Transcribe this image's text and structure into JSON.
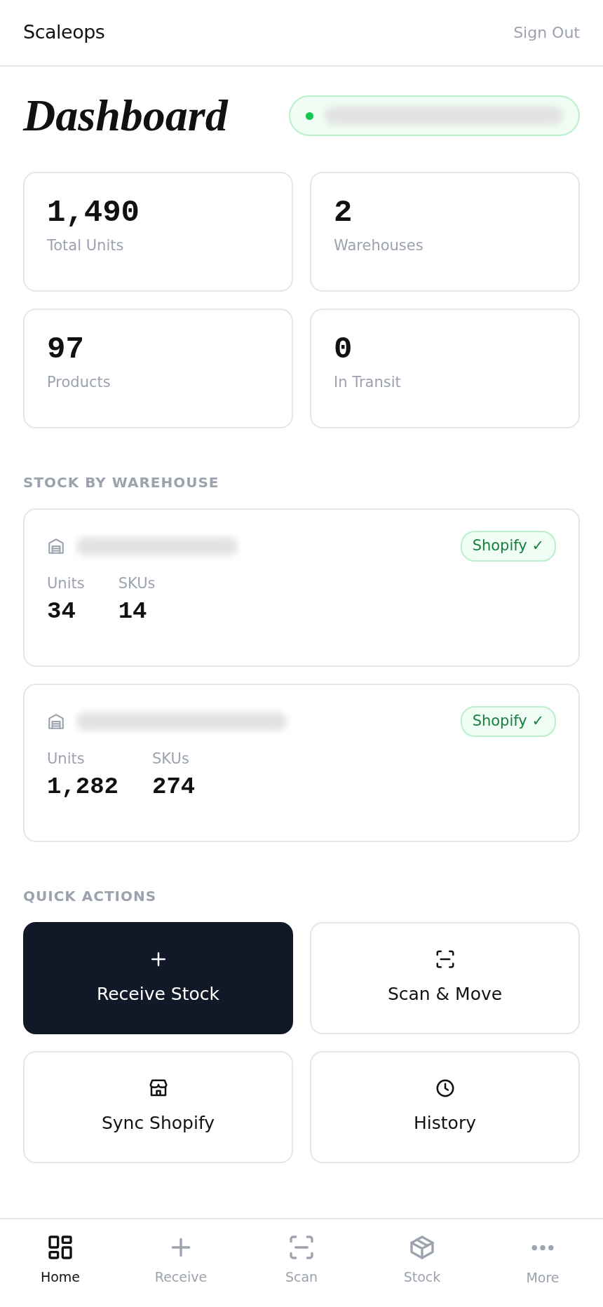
{
  "header": {
    "brand": "Scaleops",
    "sign_out": "Sign Out"
  },
  "page_title": "Dashboard",
  "stats": [
    {
      "value": "1,490",
      "label": "Total Units"
    },
    {
      "value": "2",
      "label": "Warehouses"
    },
    {
      "value": "97",
      "label": "Products"
    },
    {
      "value": "0",
      "label": "In Transit"
    }
  ],
  "warehouses_section": {
    "title": "STOCK BY WAREHOUSE",
    "warehouses": [
      {
        "badge": "Shopify ✓",
        "units_label": "Units",
        "units": "34",
        "skus_label": "SKUs",
        "skus": "14"
      },
      {
        "badge": "Shopify ✓",
        "units_label": "Units",
        "units": "1,282",
        "skus_label": "SKUs",
        "skus": "274"
      }
    ]
  },
  "quick_actions": {
    "title": "QUICK ACTIONS",
    "actions": [
      {
        "label": "Receive Stock",
        "kind": "primary"
      },
      {
        "label": "Scan & Move",
        "kind": "outline"
      },
      {
        "label": "Sync Shopify",
        "kind": "outline"
      },
      {
        "label": "History",
        "kind": "outline"
      }
    ]
  },
  "bottom_nav": [
    {
      "label": "Home",
      "selected": true
    },
    {
      "label": "Receive",
      "selected": false
    },
    {
      "label": "Scan",
      "selected": false
    },
    {
      "label": "Stock",
      "selected": false
    },
    {
      "label": "More",
      "selected": false
    }
  ]
}
